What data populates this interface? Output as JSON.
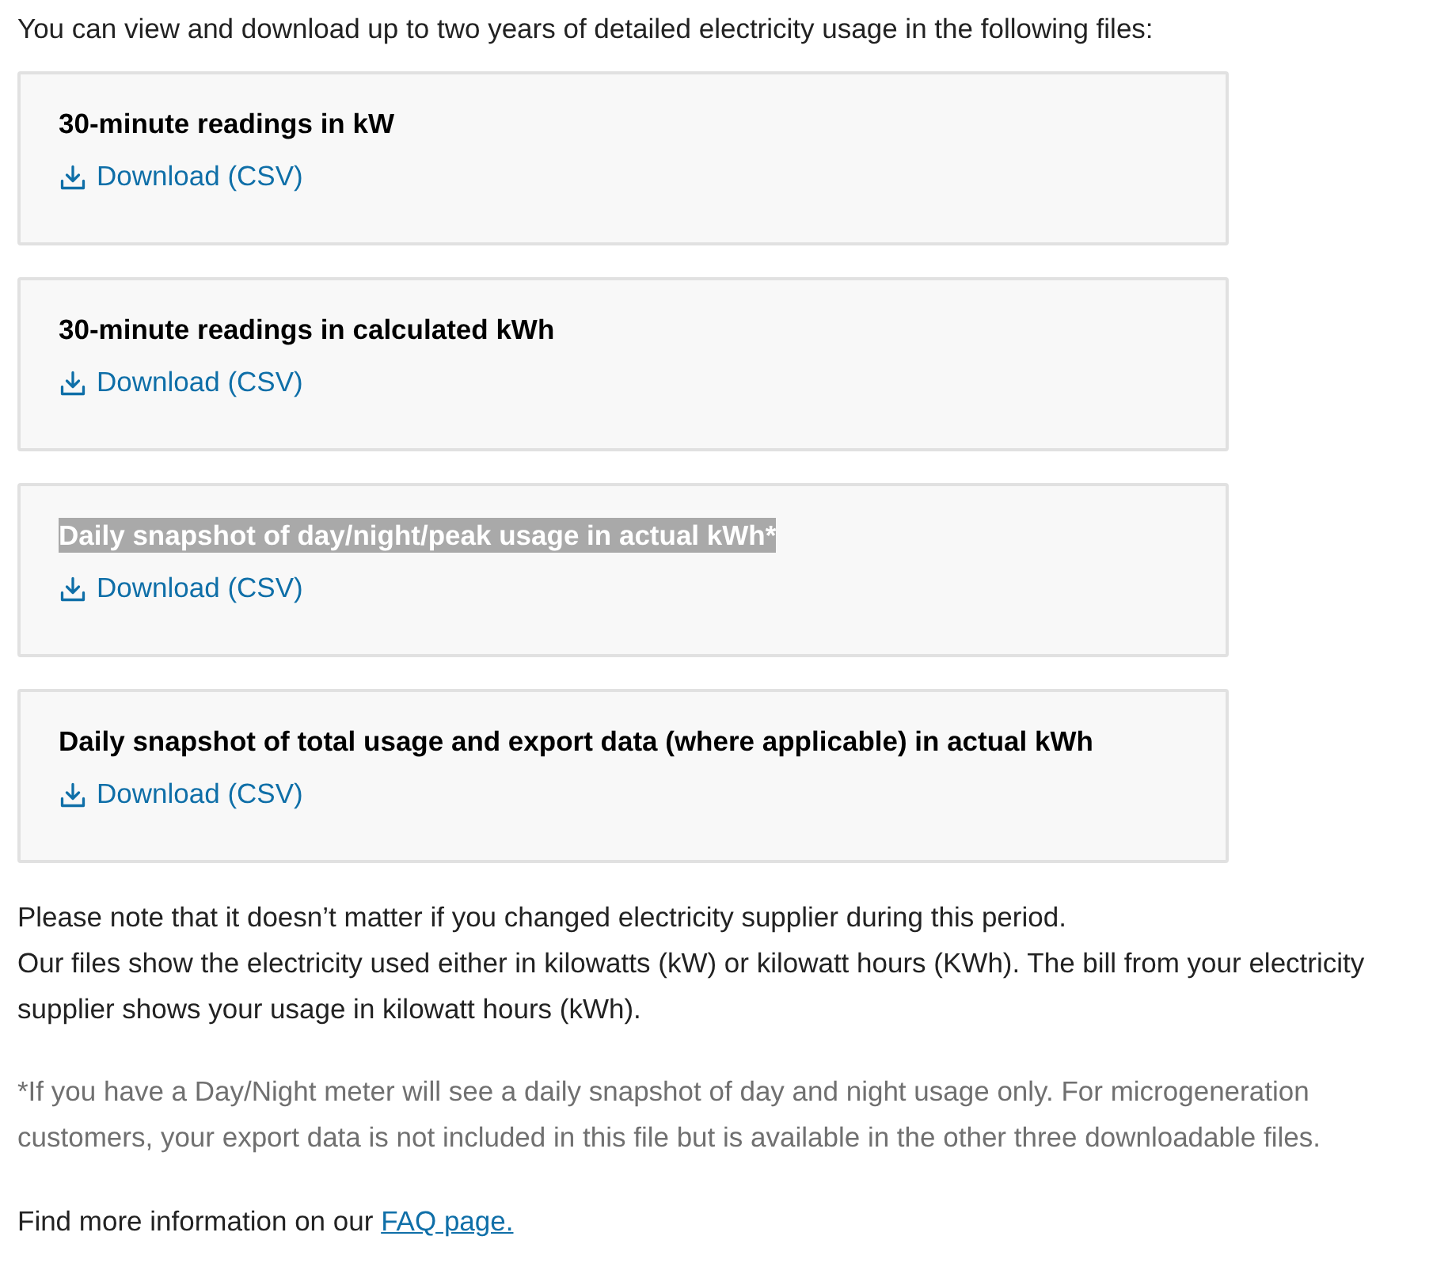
{
  "intro": "You can view and download up to two years of detailed electricity usage in the following files:",
  "files": [
    {
      "title": "30-minute readings in kW",
      "highlighted": false,
      "link": "Download (CSV)"
    },
    {
      "title": "30-minute readings in calculated kWh",
      "highlighted": false,
      "link": "Download (CSV)"
    },
    {
      "title": "Daily snapshot of day/night/peak usage in actual kWh*",
      "highlighted": true,
      "link": "Download (CSV)"
    },
    {
      "title": "Daily snapshot of total usage and export data (where applicable) in actual kWh",
      "highlighted": false,
      "link": "Download (CSV)"
    }
  ],
  "notes": [
    "Please note that it doesn’t matter if you changed electricity supplier during this period.",
    "Our files show the electricity used either in kilowatts (kW) or kilowatt hours (KWh). The bill from your electricity supplier shows your usage in kilowatt hours (kWh)."
  ],
  "footnote": "*If you have a Day/Night meter will see a daily snapshot of day and night usage only. For microgeneration customers, your export data is not included in this file but is available in the other three downloadable files.",
  "more_info": {
    "text": "Find more information on our",
    "link": "FAQ page."
  }
}
